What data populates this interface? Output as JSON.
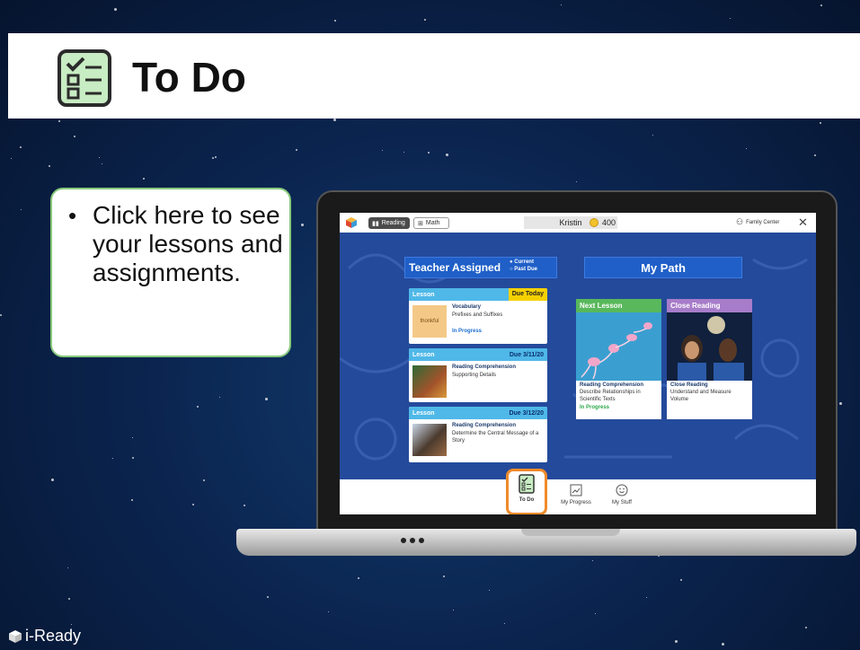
{
  "slide": {
    "title": "To Do",
    "title_icon": "checklist-icon",
    "callout_text": "Click here to see your lessons and assignments.",
    "brand": "i-Ready",
    "accent_color": "#f08a2a"
  },
  "app": {
    "tabs": [
      {
        "label": "Reading",
        "icon": "book-icon",
        "selected": true
      },
      {
        "label": "Math",
        "icon": "math-icon",
        "selected": false
      }
    ],
    "student_name": "Kristin",
    "coins": "400",
    "family_center": "Family Center",
    "sections": {
      "teacher_assigned": "Teacher Assigned",
      "legend_current": "● Current",
      "legend_past_due": "○ Past Due",
      "my_path": "My Path"
    },
    "lessons": [
      {
        "label": "Lesson",
        "due": "Due Today",
        "title": "Vocabulary",
        "subtitle": "Prefixes and Suffixes",
        "status": "In Progress",
        "thumb_word": "thonkful"
      },
      {
        "label": "Lesson",
        "due": "Due 3/11/20",
        "title": "Reading Comprehension",
        "subtitle": "Supporting Details",
        "status": ""
      },
      {
        "label": "Lesson",
        "due": "Due 3/12/20",
        "title": "Reading Comprehension",
        "subtitle": "Determine the Central Message of a Story",
        "status": ""
      }
    ],
    "path": [
      {
        "header": "Next Lesson",
        "color": "#58b85b",
        "title": "Reading Comprehension",
        "subtitle": "Describe Relationships in Scientific Texts",
        "status": "In Progress"
      },
      {
        "header": "Close Reading",
        "color": "#a77cc9",
        "title": "Close Reading",
        "subtitle": "Understand and Measure Volume",
        "status": ""
      }
    ],
    "bottom_nav": [
      {
        "label": "To Do",
        "icon": "checklist-icon",
        "active": true
      },
      {
        "label": "My Progress",
        "icon": "chart-icon",
        "active": false
      },
      {
        "label": "My Stuff",
        "icon": "smiley-icon",
        "active": false
      }
    ]
  }
}
